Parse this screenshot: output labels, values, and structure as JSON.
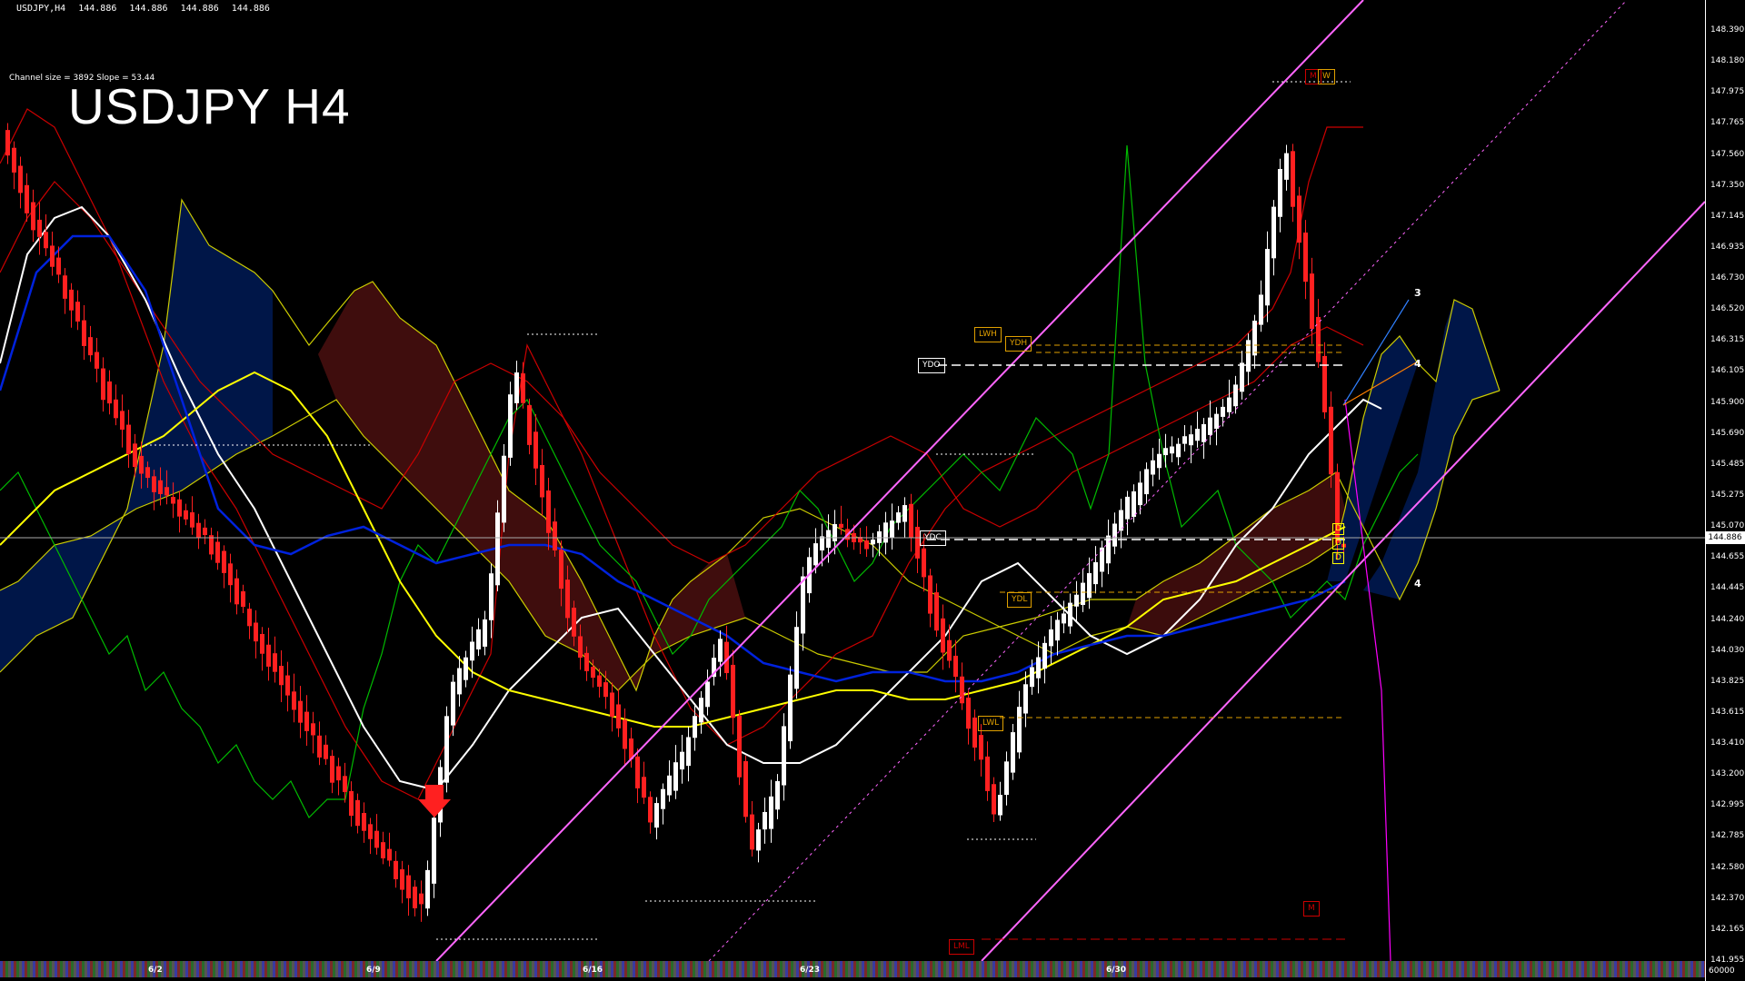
{
  "header": {
    "symbol": "USDJPY,H4",
    "ohlc": [
      "144.886",
      "144.886",
      "144.886",
      "144.886"
    ],
    "channel_info": "Channel size = 3892 Slope = 53.44",
    "title": "USDJPY H4"
  },
  "price_axis": {
    "ticks": [
      "148.390",
      "148.180",
      "147.975",
      "147.765",
      "147.560",
      "147.350",
      "147.145",
      "146.935",
      "146.730",
      "146.520",
      "146.315",
      "146.105",
      "145.900",
      "145.690",
      "145.485",
      "145.275",
      "145.070",
      "144.655",
      "144.445",
      "144.240",
      "144.030",
      "143.825",
      "143.615",
      "143.410",
      "143.200",
      "142.995",
      "142.785",
      "142.580",
      "142.370",
      "142.165",
      "141.955"
    ],
    "current_price": "144.886",
    "bottom_value": "60000"
  },
  "time_axis": {
    "labels": [
      "6/2",
      "6/9",
      "6/16",
      "6/23",
      "6/30"
    ]
  },
  "level_labels": {
    "lwh": "LWH",
    "ydh": "YDH",
    "ydo": "YDO",
    "ydc": "YDC",
    "ydl": "YDL",
    "lwl": "LWL",
    "lml": "LML",
    "m_top": "M",
    "w_top": "W",
    "m_bottom": "M",
    "d1": "D",
    "d2": "D",
    "d3": "D"
  },
  "wave_labels": [
    "3",
    "4",
    "4"
  ],
  "colors": {
    "background": "#000000",
    "bull_candle": "#ffffff",
    "bear_candle": "#ff0000",
    "channel": "#ff66ff",
    "ma_yellow": "#ffff00",
    "ma_white": "#ffffff",
    "ma_blue": "#0022dd",
    "bands": "#cc0000",
    "oscillator": "#00bb00",
    "cloud_outline": "#cccc00"
  },
  "chart_data": {
    "type": "candlestick",
    "symbol": "USDJPY",
    "timeframe": "H4",
    "ylim": [
      141.955,
      148.39
    ],
    "current_price": 144.886
  }
}
